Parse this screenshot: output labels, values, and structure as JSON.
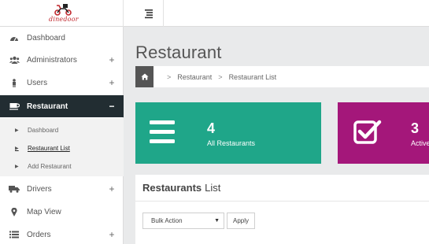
{
  "logo": {
    "text": "dinedoor"
  },
  "sidebar": {
    "items": [
      {
        "label": "Dashboard",
        "icon": "tachometer-icon",
        "sign": ""
      },
      {
        "label": "Administrators",
        "icon": "users-icon",
        "sign": "+"
      },
      {
        "label": "Users",
        "icon": "user-icon",
        "sign": "+"
      },
      {
        "label": "Restaurant",
        "icon": "coffee-cup-icon",
        "sign": "−"
      },
      {
        "label": "Drivers",
        "icon": "truck-icon",
        "sign": "+"
      },
      {
        "label": "Map View",
        "icon": "map-marker-icon",
        "sign": ""
      },
      {
        "label": "Orders",
        "icon": "list-icon",
        "sign": "+"
      }
    ],
    "submenu": [
      {
        "label": "Dashboard"
      },
      {
        "label": "Restaurant List"
      },
      {
        "label": "Add Restaurant"
      }
    ]
  },
  "page": {
    "title": "Restaurant"
  },
  "breadcrumb": [
    "Restaurant",
    "Restaurant List"
  ],
  "cards": [
    {
      "number": "4",
      "label": "All Restaurants",
      "color": "#1fa689",
      "icon": "bars-icon"
    },
    {
      "number": "3",
      "label": "Active",
      "color": "#a4177a",
      "icon": "check-square-icon"
    }
  ],
  "panel": {
    "title_bold": "Restaurants",
    "title_rest": "List",
    "bulk_action": "Bulk Action",
    "apply_label": "Apply"
  }
}
